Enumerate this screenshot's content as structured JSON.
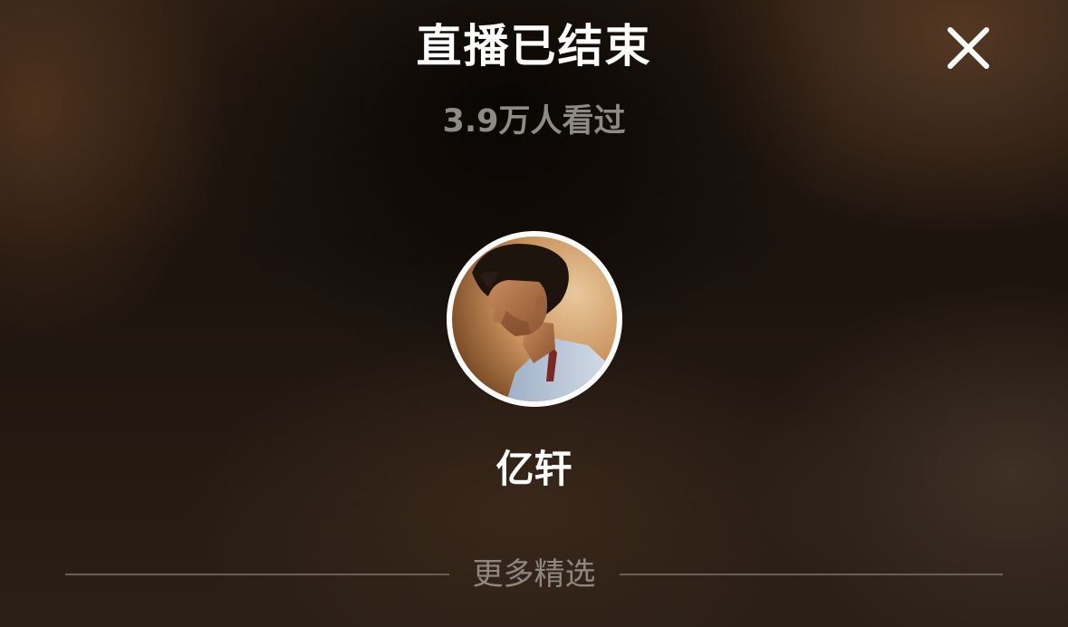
{
  "live_ended": {
    "title": "直播已结束",
    "viewers_text": "3.9万人看过",
    "close_icon": "close-icon"
  },
  "streamer": {
    "name": "亿轩",
    "avatar_icon": "avatar-photo"
  },
  "more_section": {
    "label": "更多精选"
  },
  "colors": {
    "title": "#ffffff",
    "subtitle": "#8e8a86",
    "avatar_border": "#ffffff",
    "divider": "#6a5f56"
  }
}
